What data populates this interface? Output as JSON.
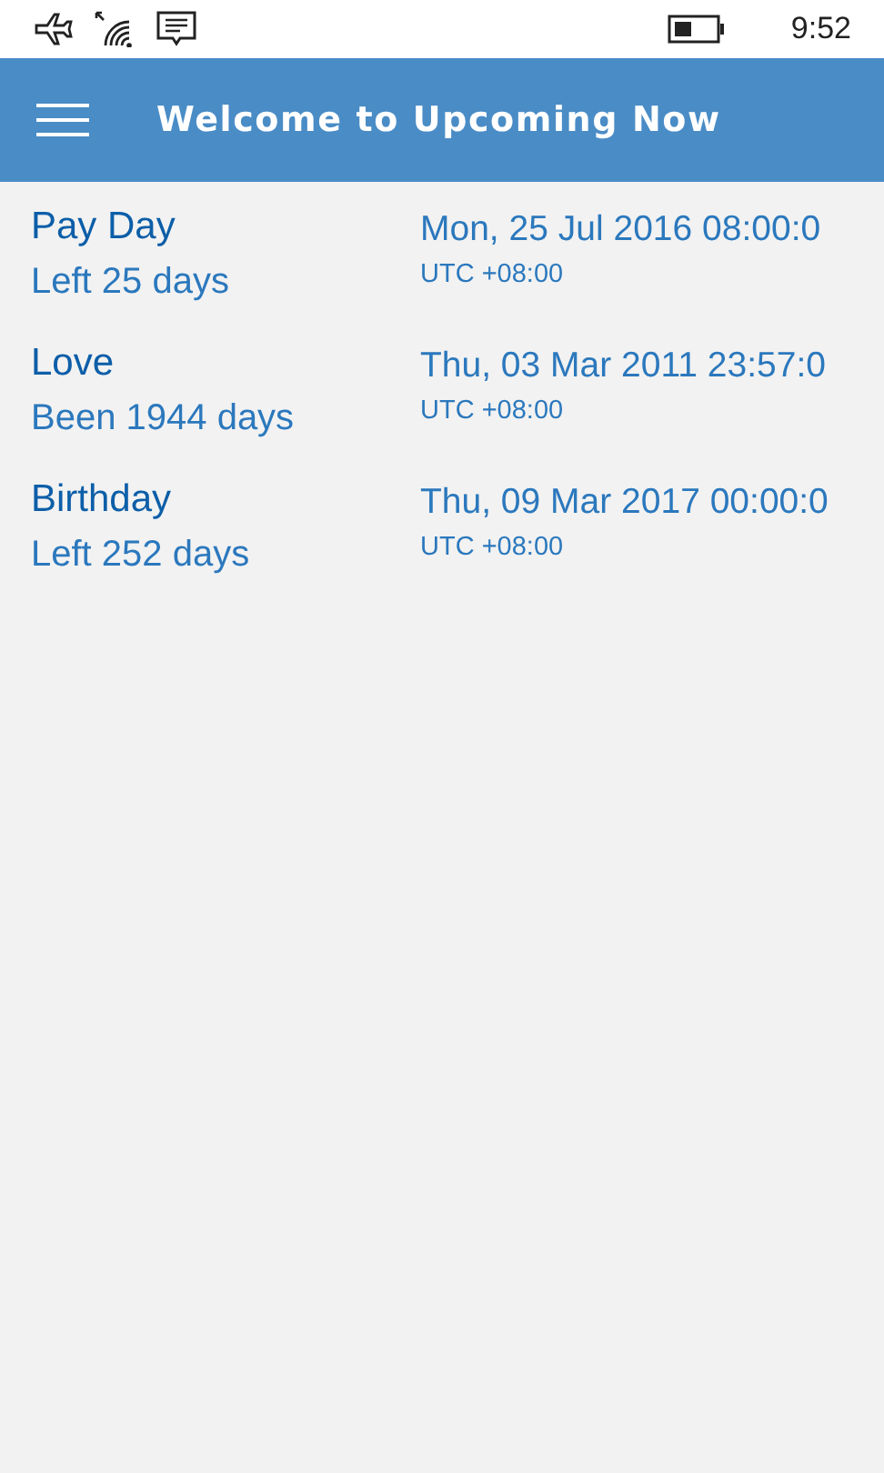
{
  "status_bar": {
    "time": "9:52"
  },
  "header": {
    "title": "Welcome to Upcoming Now"
  },
  "events": [
    {
      "name": "Pay Day",
      "relative": "Left 25 days",
      "date": "Mon, 25 Jul 2016 08:00:0",
      "timezone": "UTC +08:00"
    },
    {
      "name": "Love",
      "relative": "Been 1944 days",
      "date": "Thu, 03 Mar 2011 23:57:0",
      "timezone": "UTC +08:00"
    },
    {
      "name": "Birthday",
      "relative": "Left 252 days",
      "date": "Thu, 09 Mar 2017 00:00:0",
      "timezone": "UTC +08:00"
    }
  ]
}
